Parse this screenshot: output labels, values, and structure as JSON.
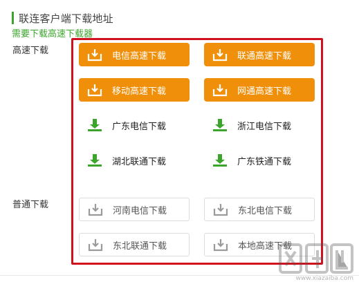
{
  "header": {
    "title": "联连客户端下载地址",
    "accent_color": "#3aa52a"
  },
  "sub_link": {
    "label": "需要下载高速下载器",
    "color": "#3aa52a"
  },
  "sections": {
    "fast_label": "高速下载",
    "normal_label": "普通下载"
  },
  "highlight_color": "#d0101c",
  "fast_buttons": [
    {
      "label": "电信高速下载",
      "icon": "download-tray-icon",
      "color": "#f0900a"
    },
    {
      "label": "联通高速下载",
      "icon": "download-tray-icon",
      "color": "#f0900a"
    },
    {
      "label": "移动高速下载",
      "icon": "download-tray-icon",
      "color": "#f0900a"
    },
    {
      "label": "网通高速下载",
      "icon": "download-tray-icon",
      "color": "#f0900a"
    }
  ],
  "green_buttons": [
    {
      "label": "广东电信下载",
      "icon": "green-download-arrow-icon",
      "color": "#3aa52a"
    },
    {
      "label": "浙江电信下载",
      "icon": "green-download-arrow-icon",
      "color": "#3aa52a"
    },
    {
      "label": "湖北联通下载",
      "icon": "green-download-arrow-icon",
      "color": "#3aa52a"
    },
    {
      "label": "广东铁通下载",
      "icon": "green-download-arrow-icon",
      "color": "#3aa52a"
    }
  ],
  "normal_buttons": [
    {
      "label": "河南电信下载",
      "icon": "gray-download-icon",
      "color": "#9a9a9a"
    },
    {
      "label": "东北电信下载",
      "icon": "gray-download-icon",
      "color": "#9a9a9a"
    },
    {
      "label": "东北联通下载",
      "icon": "gray-download-icon",
      "color": "#9a9a9a"
    },
    {
      "label": "本地高速下载",
      "icon": "gray-download-icon",
      "color": "#9a9a9a"
    }
  ],
  "watermark": {
    "text": "下载吧",
    "url": "www.xiazaiba.com"
  }
}
